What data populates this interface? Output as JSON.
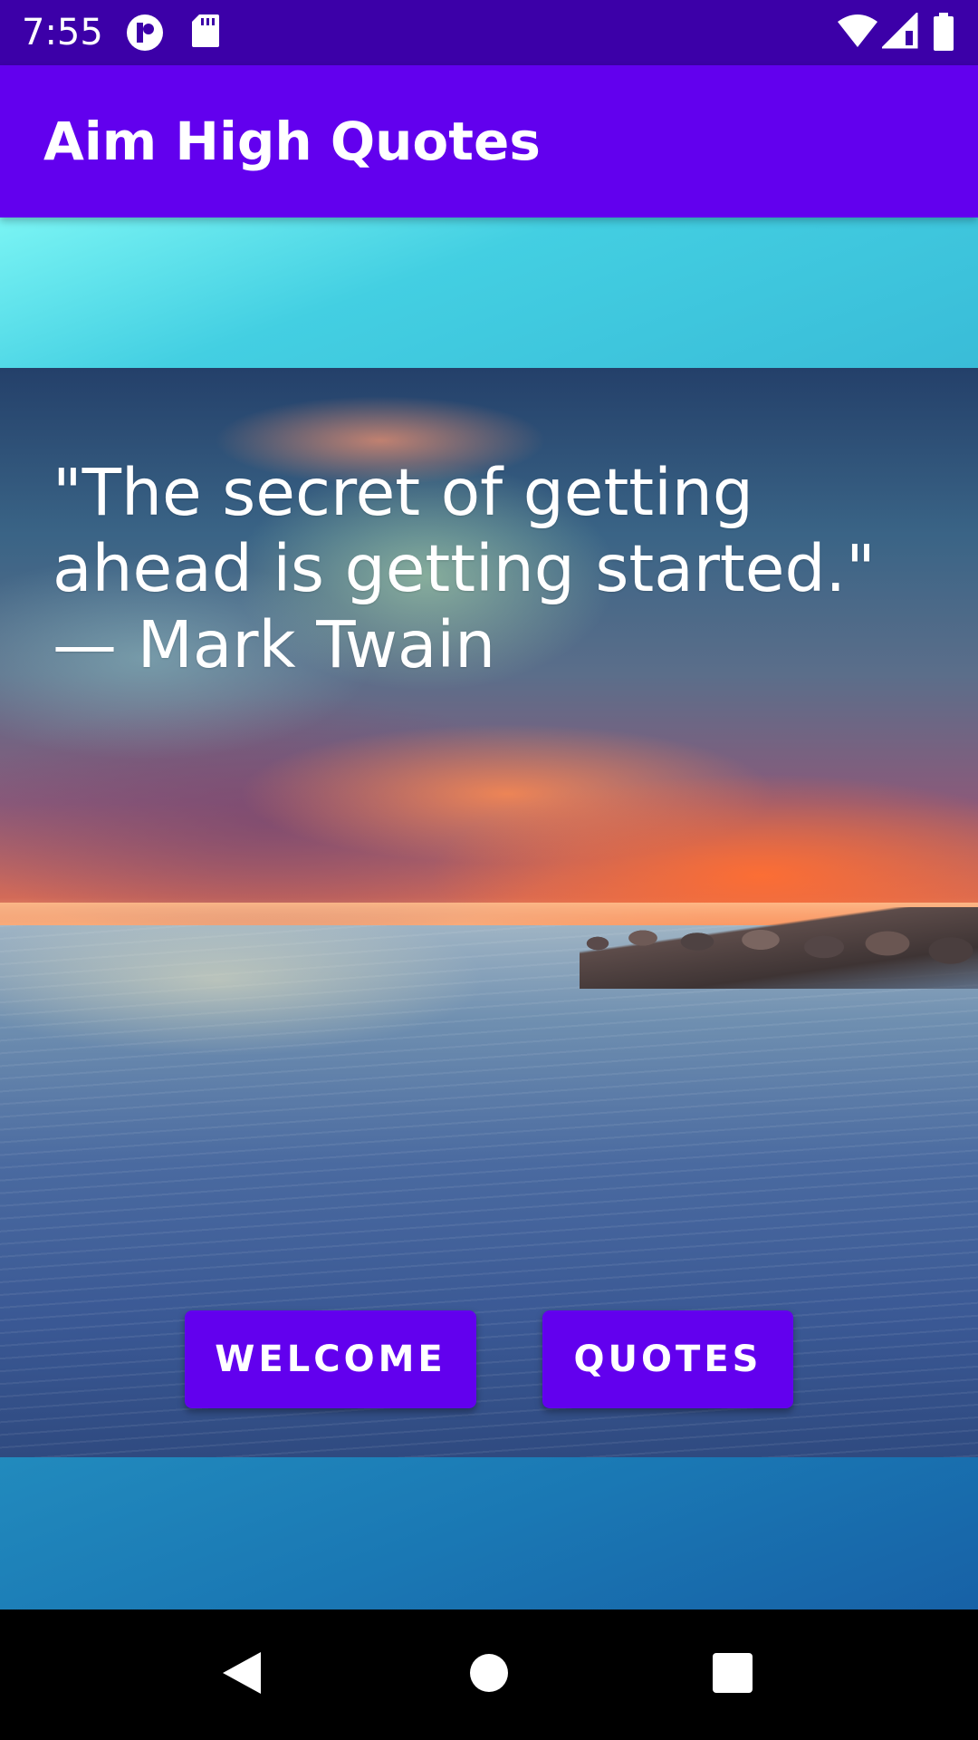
{
  "status_bar": {
    "time": "7:55",
    "icons": [
      "app-notification-icon",
      "sd-card-icon",
      "wifi-icon",
      "cell-signal-icon",
      "battery-icon"
    ]
  },
  "app_bar": {
    "title": "Aim High Quotes",
    "color": "#6200ee"
  },
  "main": {
    "quote": "\"The secret of getting ahead is getting started.\" — Mark Twain",
    "buttons": {
      "welcome_label": "WELCOME",
      "quotes_label": "QUOTES"
    },
    "accent": "#6200ee"
  },
  "nav_bar": {
    "icons": [
      "back-icon",
      "home-icon",
      "recents-icon"
    ]
  }
}
